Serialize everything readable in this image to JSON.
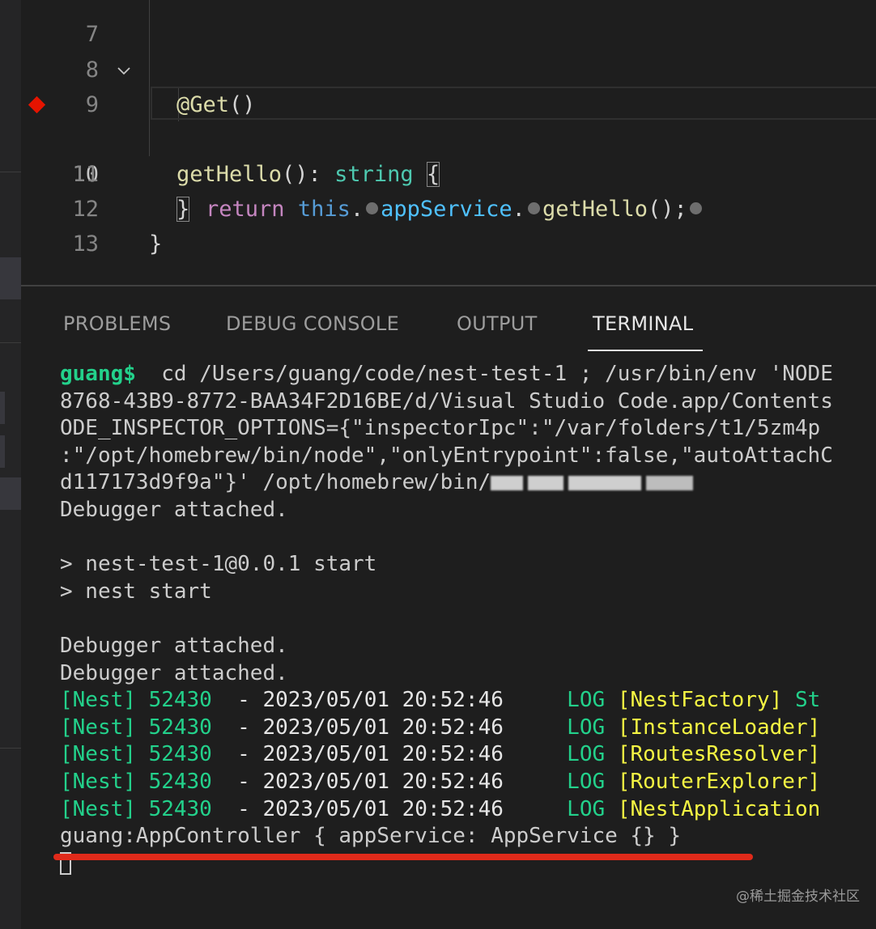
{
  "editor": {
    "lines": [
      {
        "num": "7"
      },
      {
        "num": "8",
        "tokens": [
          "@Get",
          "()"
        ]
      },
      {
        "num": "9",
        "tokens": [
          "getHello",
          "(): ",
          "string",
          " ",
          "{"
        ]
      },
      {
        "num": "10",
        "tokens": [
          "return",
          " ",
          "this",
          ".",
          "appService",
          ".",
          "getHello",
          "();"
        ]
      },
      {
        "num": "11",
        "tokens": [
          "}"
        ]
      },
      {
        "num": "12",
        "tokens": [
          "}"
        ]
      },
      {
        "num": "13"
      }
    ]
  },
  "panel": {
    "tabs": [
      "PROBLEMS",
      "DEBUG CONSOLE",
      "OUTPUT",
      "TERMINAL"
    ],
    "active_tab": "TERMINAL"
  },
  "terminal": {
    "prompt": "guang$",
    "command_line_1": "  cd /Users/guang/code/nest-test-1 ; /usr/bin/env 'NODE",
    "command_line_2": "8768-43B9-8772-BAA34F2D16BE/d/Visual Studio Code.app/Contents",
    "command_line_3": "ODE_INSPECTOR_OPTIONS={\"inspectorIpc\":\"/var/folders/t1/5zm4p",
    "command_line_4": ":\"/opt/homebrew/bin/node\",\"onlyEntrypoint\":false,\"autoAttachC",
    "command_line_5": "d117173d9f9a\"}' /opt/homebrew/bin/",
    "debugger_attached": "Debugger attached.",
    "script_line_1": "> nest-test-1@0.0.1 start",
    "script_line_2": "> nest start",
    "log_lines": [
      {
        "prefix": "[Nest] 52430",
        "sep": "  - ",
        "time": "2023/05/01 20:52:46",
        "level": "LOG",
        "context": "[NestFactory]",
        "rest": " St"
      },
      {
        "prefix": "[Nest] 52430",
        "sep": "  - ",
        "time": "2023/05/01 20:52:46",
        "level": "LOG",
        "context": "[InstanceLoader]",
        "rest": ""
      },
      {
        "prefix": "[Nest] 52430",
        "sep": "  - ",
        "time": "2023/05/01 20:52:46",
        "level": "LOG",
        "context": "[RoutesResolver]",
        "rest": ""
      },
      {
        "prefix": "[Nest] 52430",
        "sep": "  - ",
        "time": "2023/05/01 20:52:46",
        "level": "LOG",
        "context": "[RouterExplorer]",
        "rest": ""
      },
      {
        "prefix": "[Nest] 52430",
        "sep": "  - ",
        "time": "2023/05/01 20:52:46",
        "level": "LOG",
        "context": "[NestApplication",
        "rest": ""
      }
    ],
    "output_line": "guang:AppController { appService: AppService {} }"
  },
  "watermark": "@稀土掘金技术社区",
  "colors": {
    "highlight_underline": "#e02a1a",
    "breakpoint": "#e51400",
    "log_green": "#23d18b",
    "log_yellow": "#f5f543"
  }
}
